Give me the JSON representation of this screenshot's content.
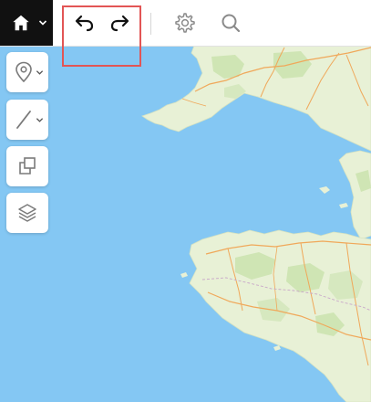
{
  "toolbar": {
    "home": {
      "icon": "home-icon",
      "dropdown_icon": "chevron-down-icon"
    },
    "undo": {
      "icon": "undo-icon"
    },
    "redo": {
      "icon": "redo-icon"
    },
    "settings": {
      "icon": "gear-icon"
    },
    "search": {
      "icon": "search-icon"
    },
    "highlight_color": "#e25555"
  },
  "sidebar": {
    "tools": [
      {
        "name": "marker-tool",
        "icon": "map-pin-icon",
        "has_dropdown": true
      },
      {
        "name": "line-tool",
        "icon": "line-icon",
        "has_dropdown": true
      },
      {
        "name": "clone-tool",
        "icon": "duplicate-icon",
        "has_dropdown": false
      },
      {
        "name": "layers-tool",
        "icon": "layers-icon",
        "has_dropdown": false
      }
    ]
  },
  "map": {
    "colors": {
      "water": "#84c7f3",
      "land": "#e8f1d6",
      "forest": "#cfe5b4",
      "roads": "#f0a85a",
      "borders": "#c9a8c9"
    }
  }
}
